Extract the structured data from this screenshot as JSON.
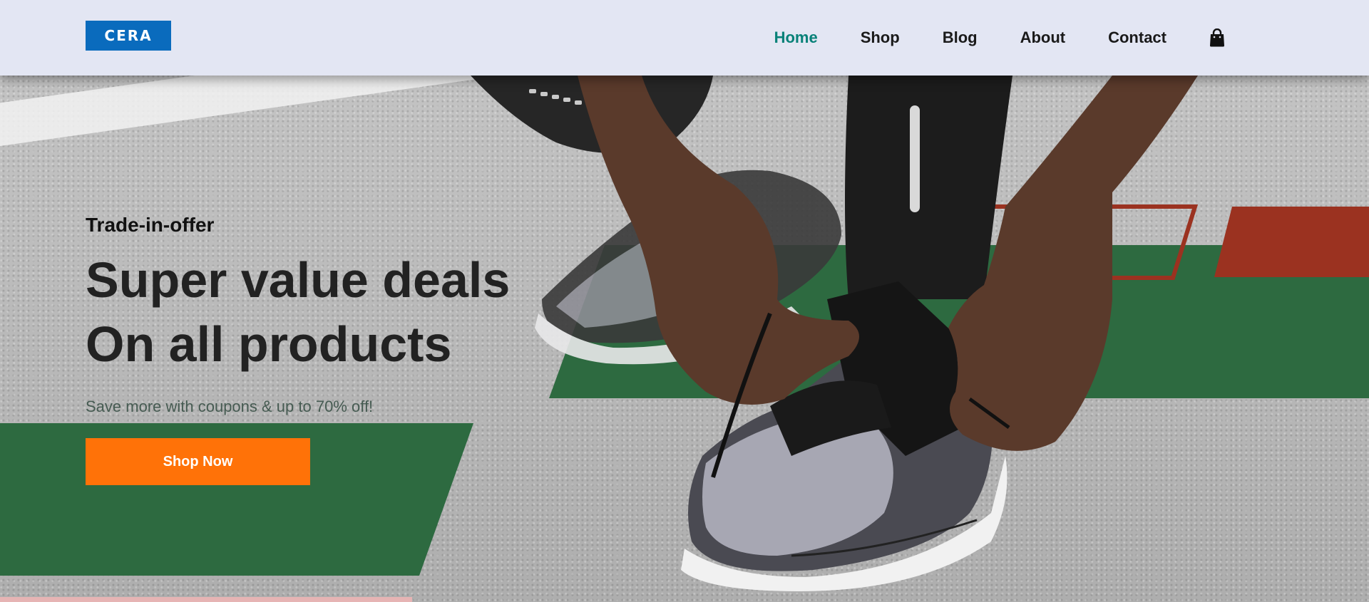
{
  "brand": {
    "logo_text": "CERA",
    "logo_color": "#0a6bbd"
  },
  "nav": {
    "items": [
      {
        "label": "Home",
        "active": true
      },
      {
        "label": "Shop",
        "active": false
      },
      {
        "label": "Blog",
        "active": false
      },
      {
        "label": "About",
        "active": false
      },
      {
        "label": "Contact",
        "active": false
      }
    ],
    "cart_icon": "shopping-bag-icon"
  },
  "hero": {
    "kicker": "Trade-in-offer",
    "headline_line1": "Super value deals",
    "headline_line2": "On all products",
    "subtext": "Save more with coupons & up to 70% off!",
    "cta_label": "Shop Now"
  },
  "colors": {
    "header_bg": "#e3e6f3",
    "nav_active": "#088178",
    "cta": "#ff7208",
    "accent_green": "#2d6a40",
    "accent_red": "#9b3220"
  }
}
